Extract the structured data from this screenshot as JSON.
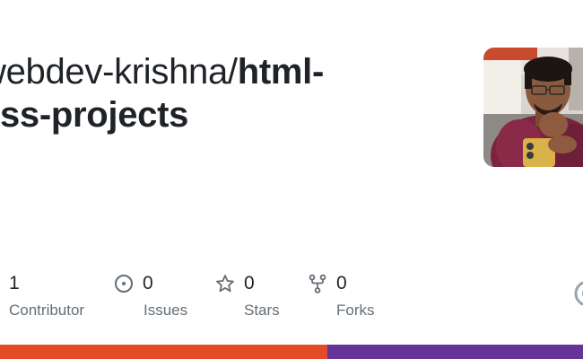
{
  "repo": {
    "owner": "webdev-krishna/",
    "name_line1": "html-",
    "name_line2": "css-projects"
  },
  "stats": {
    "contributors": {
      "value": "1",
      "label": "Contributor",
      "icon": "people-icon"
    },
    "issues": {
      "value": "0",
      "label": "Issues",
      "icon": "issue-circle-icon"
    },
    "stars": {
      "value": "0",
      "label": "Stars",
      "icon": "star-icon"
    },
    "forks": {
      "value": "0",
      "label": "Forks",
      "icon": "fork-icon"
    }
  },
  "languages": [
    {
      "color": "#e34c26",
      "share": 0.562
    },
    {
      "color": "#663399",
      "share": 0.438
    }
  ],
  "colors": {
    "text": "#1f2328",
    "muted": "#656d76",
    "html": "#e34c26",
    "css": "#663399"
  }
}
